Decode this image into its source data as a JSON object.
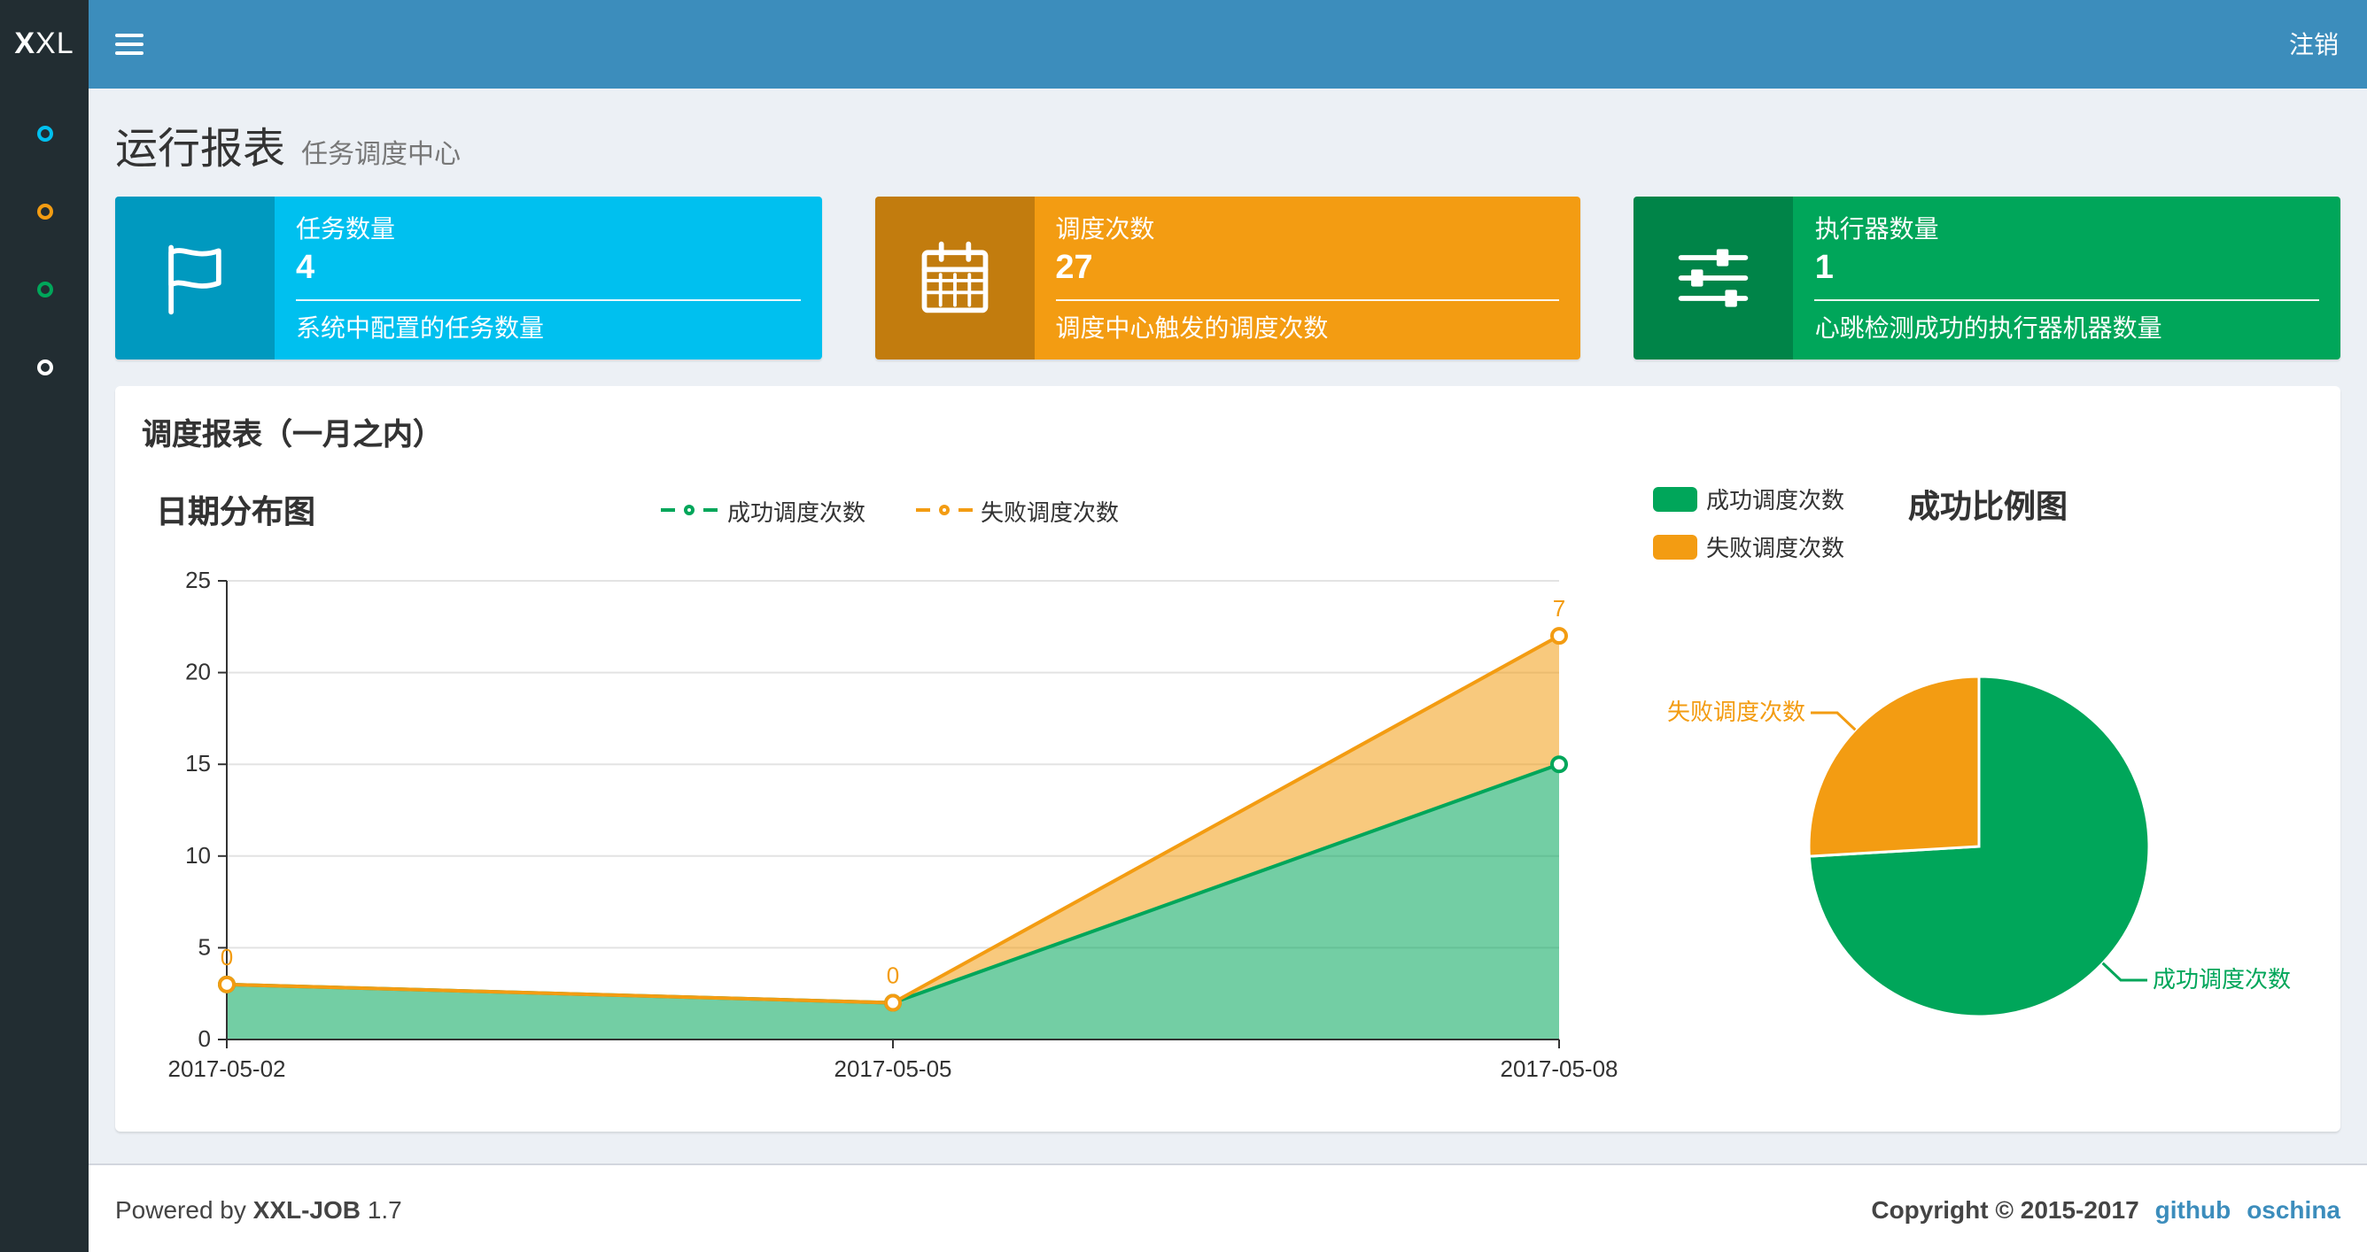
{
  "navbar": {
    "logo_bold": "X",
    "logo_rest": "XL",
    "menu_icon": "hamburger-icon",
    "logout": "注销"
  },
  "sidebar": {
    "items": [
      {
        "icon": "circle-icon",
        "color": "#00c0ef"
      },
      {
        "icon": "circle-icon",
        "color": "#f39c12"
      },
      {
        "icon": "circle-icon",
        "color": "#00a65a"
      },
      {
        "icon": "circle-icon",
        "color": "#ffffff"
      }
    ]
  },
  "header": {
    "title": "运行报表",
    "subtitle": "任务调度中心"
  },
  "info_boxes": [
    {
      "icon": "flag-icon",
      "title": "任务数量",
      "value": "4",
      "description": "系统中配置的任务数量",
      "color": "#00c0ef"
    },
    {
      "icon": "calendar-icon",
      "title": "调度次数",
      "value": "27",
      "description": "调度中心触发的调度次数",
      "color": "#f39c12"
    },
    {
      "icon": "sliders-icon",
      "title": "执行器数量",
      "value": "1",
      "description": "心跳检测成功的执行器机器数量",
      "color": "#00a65a"
    }
  ],
  "panel": {
    "title": "调度报表（一月之内）"
  },
  "chart_data": [
    {
      "type": "area",
      "title": "日期分布图",
      "x": [
        "2017-05-02",
        "2017-05-05",
        "2017-05-08"
      ],
      "series": [
        {
          "name": "成功调度次数",
          "values": [
            3,
            2,
            15
          ],
          "color": "#00a65a",
          "labeled": false
        },
        {
          "name": "失败调度次数",
          "values": [
            0,
            0,
            7
          ],
          "color": "#f39c12",
          "labeled": true
        }
      ],
      "stacked": true,
      "ylim": [
        0,
        25
      ],
      "yticks": [
        0,
        5,
        10,
        15,
        20,
        25
      ],
      "grid": true,
      "legend_position": "top-center"
    },
    {
      "type": "pie",
      "title": "成功比例图",
      "slices": [
        {
          "name": "成功调度次数",
          "value": 20,
          "color": "#00a65a"
        },
        {
          "name": "失败调度次数",
          "value": 7,
          "color": "#f39c12"
        }
      ],
      "legend_position": "top-left"
    }
  ],
  "footer": {
    "powered_prefix": "Powered by",
    "product": "XXL-JOB",
    "version": "1.7",
    "copyright": "Copyright © 2015-2017",
    "links": [
      "github",
      "oschina"
    ]
  },
  "colors": {
    "navbar": "#3c8dbc",
    "sidebar": "#222d32",
    "body_bg": "#ecf0f5",
    "aqua": "#00c0ef",
    "yellow": "#f39c12",
    "green": "#00a65a",
    "link": "#3c8dbc"
  }
}
